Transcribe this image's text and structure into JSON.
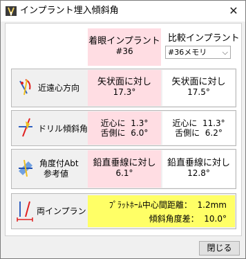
{
  "window": {
    "title": "インプラント埋入傾斜角",
    "close_glyph": "✕"
  },
  "header": {
    "focus_label": "着眼インプラント",
    "focus_value": "#36",
    "compare_label": "比較インプラント",
    "compare_select": "#36メモリ"
  },
  "rows": {
    "mesiodistal": {
      "label": "近遠心方向",
      "left_line1": "矢状面に対し",
      "left_line2": "17.3°",
      "right_line1": "矢状面に対し",
      "right_line2": "17.5°"
    },
    "drill": {
      "label": "ドリル傾斜角",
      "left_a": "近心に  1.3°",
      "left_b": "舌側に  6.0°",
      "right_a": "近心に  11.3°",
      "right_b": "舌側に  6.2°"
    },
    "abt": {
      "label1": "角度付Abt",
      "label2": "参考値",
      "left_line1": "鉛直垂線に対し",
      "left_line2": "6.1°",
      "right_line1": "鉛直垂線に対し",
      "right_line2": "12.8°"
    },
    "between": {
      "label": "両インプラント間",
      "line1": "ﾌﾟﾗｯﾄﾎｰﾑ中心間距離：  1.2mm",
      "line2": "傾斜角度差：  10.0°"
    }
  },
  "footer": {
    "close_button": "閉じる"
  },
  "colors": {
    "pink": "#ffdde3",
    "yellow": "#ffff66",
    "accent_red": "#e02020"
  }
}
